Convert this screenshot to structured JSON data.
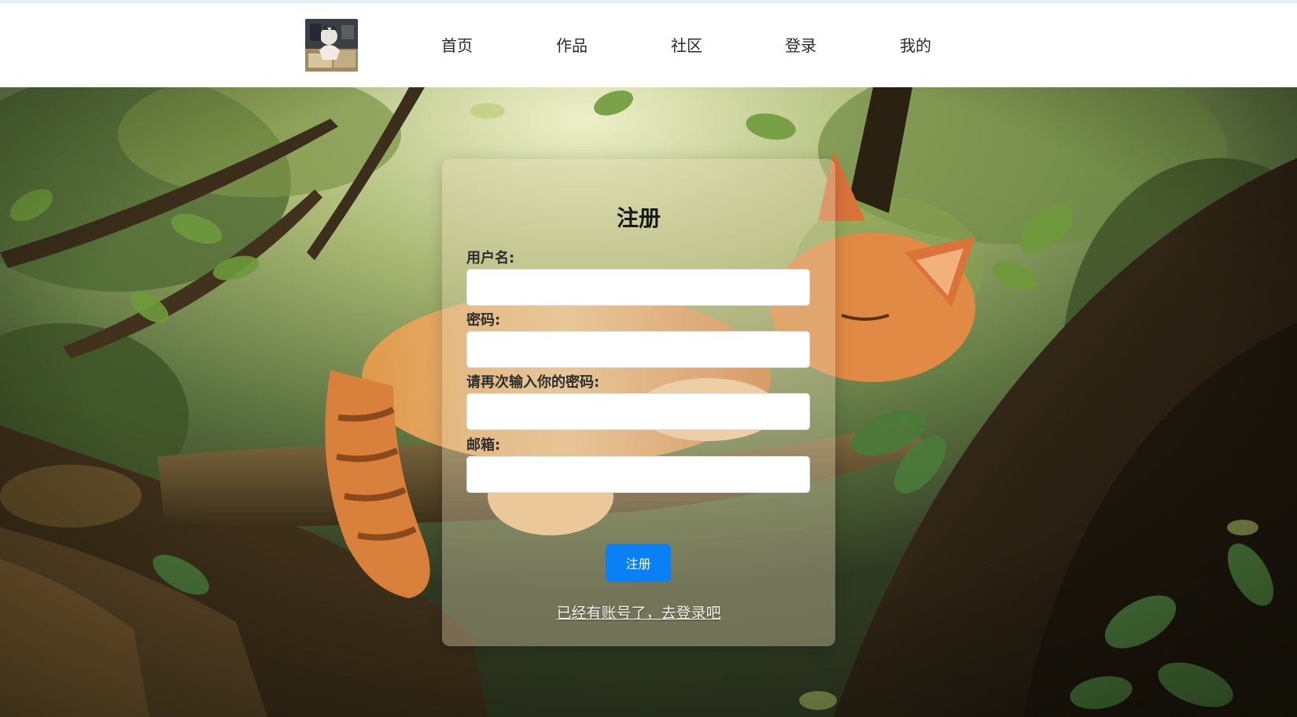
{
  "nav": {
    "logo_alt": "logo",
    "items": [
      {
        "label": "首页"
      },
      {
        "label": "作品"
      },
      {
        "label": "社区"
      },
      {
        "label": "登录"
      },
      {
        "label": "我的"
      }
    ]
  },
  "register": {
    "title": "注册",
    "fields": [
      {
        "label": "用户名:",
        "value": ""
      },
      {
        "label": "密码:",
        "value": ""
      },
      {
        "label": "请再次输入你的密码:",
        "value": ""
      },
      {
        "label": "邮箱:",
        "value": ""
      }
    ],
    "submit_label": "注册",
    "login_link": "已经有账号了，去登录吧"
  },
  "colors": {
    "primary_button": "#0a80f5",
    "header_bg": "#ffffff"
  }
}
